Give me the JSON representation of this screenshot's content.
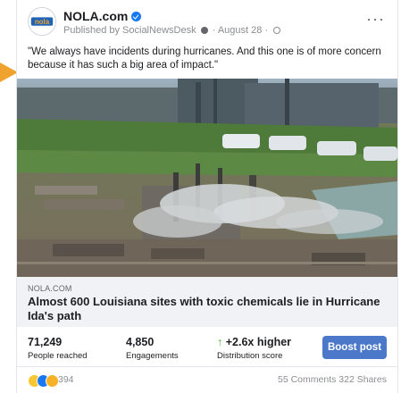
{
  "colors": {
    "accent": "#f0a22e",
    "brand_blue": "#1877f2",
    "boost_blue": "#4c78c9",
    "growth_green": "#42b72a"
  },
  "post": {
    "page_name": "NOLA.com",
    "avatar_text": "nola",
    "published_by": "Published by SocialNewsDesk",
    "date": "August 28",
    "caption": "\"We always have incidents during hurricanes. And this one is of more concern because it has such a big area of impact.\""
  },
  "link": {
    "domain": "NOLA.COM",
    "headline": "Almost 600 Louisiana sites with toxic chemicals lie in Hurricane Ida's path"
  },
  "insights": {
    "people_reached": {
      "value": "71,249",
      "label": "People reached"
    },
    "engagements": {
      "value": "4,850",
      "label": "Engagements"
    },
    "distribution": {
      "value": "+2.6x higher",
      "arrow": "↑",
      "label": "Distribution score"
    },
    "boost_label": "Boost post"
  },
  "footer": {
    "reaction_icons": [
      "haha-icon",
      "like-icon",
      "wow-icon"
    ],
    "reaction_count": "394",
    "comments": "55 Comments",
    "shares": "322 Shares"
  }
}
